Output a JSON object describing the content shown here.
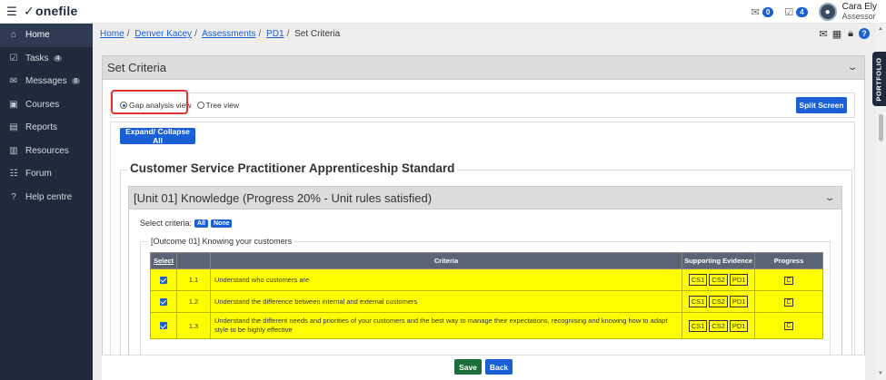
{
  "app": {
    "logo": "onefile"
  },
  "topbar": {
    "mail_count": "0",
    "tasks_count": "4",
    "user_name": "Cara Ely",
    "user_role": "Assessor"
  },
  "sidebar": {
    "items": [
      {
        "label": "Home",
        "icon": "home-icon",
        "glyph": "⌂"
      },
      {
        "label": "Tasks",
        "icon": "tasks-icon",
        "glyph": "☑",
        "count": "4"
      },
      {
        "label": "Messages",
        "icon": "messages-icon",
        "glyph": "✉",
        "count": "0"
      },
      {
        "label": "Courses",
        "icon": "courses-icon",
        "glyph": "▣"
      },
      {
        "label": "Reports",
        "icon": "reports-icon",
        "glyph": "▤"
      },
      {
        "label": "Resources",
        "icon": "resources-icon",
        "glyph": "▥"
      },
      {
        "label": "Forum",
        "icon": "forum-icon",
        "glyph": "☷"
      },
      {
        "label": "Help centre",
        "icon": "help-icon",
        "glyph": "?"
      }
    ]
  },
  "breadcrumb": {
    "links": [
      "Home",
      "Denver Kacey",
      "Assessments",
      "PD1"
    ],
    "current": "Set Criteria"
  },
  "panel": {
    "title": "Set Criteria"
  },
  "view": {
    "gap_analysis": "Gap analysis view",
    "tree_view": "Tree view",
    "split_screen": "Split Screen"
  },
  "expand_label": "Expand/ Collapse All",
  "standard_title": "Customer Service Practitioner Apprenticeship Standard",
  "unit": {
    "title": "[Unit 01] Knowledge (Progress 20% - Unit rules satisfied)",
    "select_criteria_label": "Select criteria:",
    "all_label": "All",
    "none_label": "None"
  },
  "outcome": {
    "title": "[Outcome 01] Knowing your customers",
    "headers": {
      "select": "Select",
      "criteria": "Criteria",
      "evidence": "Supporting Evidence",
      "progress": "Progress"
    },
    "rows": [
      {
        "num": "1.1",
        "text": "Understand who customers are",
        "evidence": [
          "CS1",
          "CS2",
          "PD1"
        ],
        "progress": "C"
      },
      {
        "num": "1.2",
        "text": "Understand the difference between internal and external customers",
        "evidence": [
          "CS1",
          "CS2",
          "PD1"
        ],
        "progress": "C"
      },
      {
        "num": "1.3",
        "text": "Understand the different needs and priorities of your customers and the best way to manage their expectations, recognising and knowing how to adapt style to be highly effective",
        "evidence": [
          "CS1",
          "CS2",
          "PD1"
        ],
        "progress": "C"
      }
    ]
  },
  "footer": {
    "save": "Save",
    "back": "Back"
  },
  "portfolio_tab": "PORTFOLIO",
  "colors": {
    "brand_blue": "#1a5fd6",
    "sidebar_bg": "#1f2a3c",
    "highlight_yellow": "#ffff00",
    "save_green": "#1b6e3a",
    "callout_red": "#e03333"
  }
}
